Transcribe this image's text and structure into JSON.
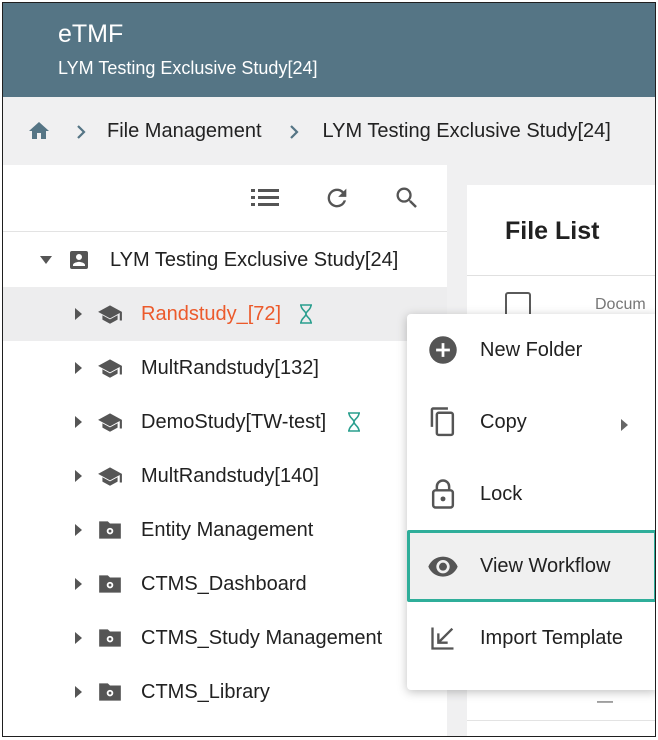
{
  "header": {
    "app_title": "eTMF",
    "study_title": "LYM Testing Exclusive Study[24]"
  },
  "breadcrumb": {
    "items": [
      "File Management",
      "LYM Testing Exclusive Study[24]"
    ]
  },
  "toolbar": {
    "icons": [
      "list-icon",
      "refresh-icon",
      "search-icon"
    ]
  },
  "tree": {
    "root": {
      "label": "LYM Testing Exclusive Study[24]",
      "icon": "account-box-icon",
      "expanded": true
    },
    "items": [
      {
        "label": "Randstudy_[72]",
        "icon": "school-icon",
        "selected": true,
        "pending": true
      },
      {
        "label": "MultRandstudy[132]",
        "icon": "school-icon",
        "selected": false,
        "pending": false
      },
      {
        "label": "DemoStudy[TW-test]",
        "icon": "school-icon",
        "selected": false,
        "pending": true
      },
      {
        "label": "MultRandstudy[140]",
        "icon": "school-icon",
        "selected": false,
        "pending": false
      },
      {
        "label": "Entity Management",
        "icon": "settings-folder-icon",
        "selected": false,
        "pending": false
      },
      {
        "label": "CTMS_Dashboard",
        "icon": "settings-folder-icon",
        "selected": false,
        "pending": false
      },
      {
        "label": "CTMS_Study Management",
        "icon": "settings-folder-icon",
        "selected": false,
        "pending": false
      },
      {
        "label": "CTMS_Library",
        "icon": "settings-folder-icon",
        "selected": false,
        "pending": false
      }
    ]
  },
  "file_list": {
    "title": "File List",
    "column_document": "Docum",
    "footer_text": "—"
  },
  "context_menu": {
    "items": [
      {
        "label": "New Folder",
        "icon": "add-circle-icon"
      },
      {
        "label": "Copy",
        "icon": "copy-icon",
        "has_submenu": true
      },
      {
        "label": "Lock",
        "icon": "lock-icon"
      },
      {
        "label": "View Workflow",
        "icon": "eye-icon",
        "highlighted": true
      },
      {
        "label": "Import Template",
        "icon": "import-icon"
      }
    ]
  },
  "colors": {
    "header_bg": "#557585",
    "selected_text": "#ec5a2b",
    "highlight_outline": "#2fae9a",
    "hourglass": "#2a9f8e"
  }
}
